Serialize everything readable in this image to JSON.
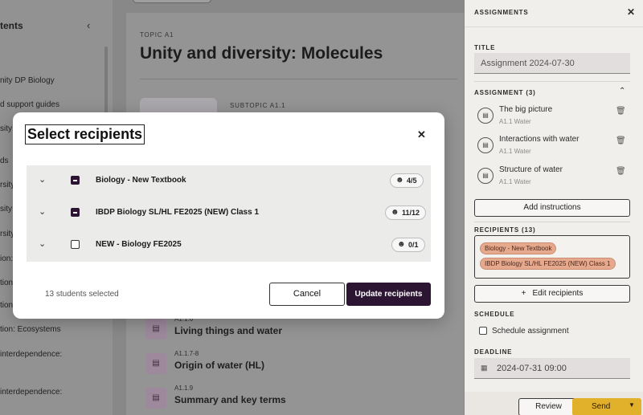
{
  "toc": {
    "title": "tents",
    "items": [
      "nity DP Biology",
      "d support guides",
      "sity:",
      "ds",
      "rsity:",
      "sity:",
      "rsity",
      "ion:",
      "tion:",
      "tion:",
      "tion: Ecosystems",
      "interdependence:",
      "interdependence:"
    ]
  },
  "topic": {
    "kicker": "TOPIC A1",
    "title": "Unity and diversity: Molecules",
    "subtopic_kicker": "SUBTOPIC A1.1",
    "lessons": [
      {
        "code": "A1.1.6",
        "title": "Living things and water"
      },
      {
        "code": "A1.1.7-8",
        "title": "Origin of water (HL)"
      },
      {
        "code": "A1.1.9",
        "title": "Summary and key terms"
      }
    ]
  },
  "panel": {
    "header": "ASSIGNMENTS",
    "title_label": "TITLE",
    "title_value": "Assignment 2024-07-30",
    "assignments_label": "ASSIGNMENT (3)",
    "assignments": [
      {
        "title": "The big picture",
        "sub": "A1.1 Water"
      },
      {
        "title": "Interactions with water",
        "sub": "A1.1 Water"
      },
      {
        "title": "Structure of water",
        "sub": "A1.1 Water"
      }
    ],
    "add_instructions": "Add instructions",
    "recipients_label": "RECIPIENTS (13)",
    "recipient_chips": [
      "Biology - New Textbook",
      "IBDP Biology SL/HL FE2025 (NEW) Class 1"
    ],
    "edit_recipients": "Edit recipients",
    "schedule_label": "SCHEDULE",
    "schedule_checkbox": "Schedule assignment",
    "deadline_label": "DEADLINE",
    "deadline_value": "2024-07-31 09:00",
    "review": "Review",
    "send": "Send"
  },
  "modal": {
    "title": "Select recipients",
    "rows": [
      {
        "label": "Biology - New Textbook",
        "count": "4/5",
        "state": "indeterminate"
      },
      {
        "label": "IBDP Biology SL/HL FE2025 (NEW) Class 1",
        "count": "11/12",
        "state": "indeterminate"
      },
      {
        "label": "NEW - Biology FE2025",
        "count": "0/1",
        "state": "unchecked"
      }
    ],
    "students_selected": "13 students selected",
    "cancel": "Cancel",
    "update": "Update recipients"
  },
  "colors": {
    "primary": "#2b1532",
    "send": "#e2b12b",
    "chip": "#e6a98e"
  }
}
